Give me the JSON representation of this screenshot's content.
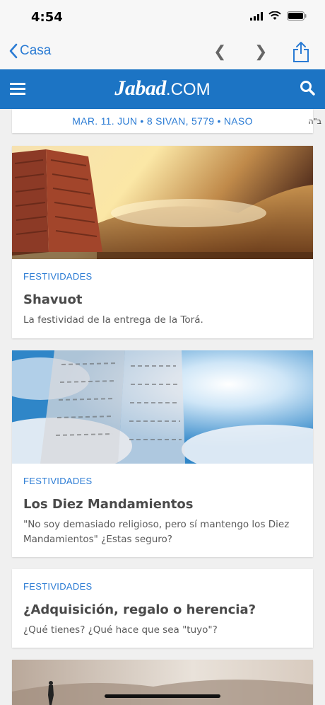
{
  "status": {
    "time": "4:54"
  },
  "nav": {
    "back_label": "Casa",
    "prev_glyph": "❮",
    "next_glyph": "❯"
  },
  "brand": {
    "name": "Jabad",
    "suffix": ".COM",
    "color": "#1c74c4",
    "accent": "#2a7bd4"
  },
  "date": {
    "text": "MAR. 11. JUN • 8 SIVAN, 5779 • NASO",
    "bh": "ב\"ה"
  },
  "cards": [
    {
      "category": "FESTIVIDADES",
      "title": "Shavuot",
      "desc": "La festividad de la entrega de la Torá."
    },
    {
      "category": "FESTIVIDADES",
      "title": "Los Diez Mandamientos",
      "desc": "\"No soy demasiado religioso, pero sí mantengo los Diez Mandamientos\" ¿Estas seguro?"
    },
    {
      "category": "FESTIVIDADES",
      "title": "¿Adquisición, regalo o herencia?",
      "desc": "¿Qué tienes? ¿Qué hace que sea \"tuyo\"?"
    }
  ]
}
